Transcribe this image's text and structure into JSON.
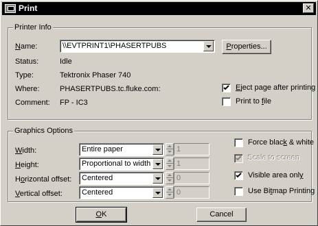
{
  "window": {
    "title": "Print",
    "close_glyph": "✕"
  },
  "printer_info": {
    "group_label": "Printer Info",
    "name_label": "Name:",
    "name_value": "\\\\EVTPRINT1\\PHASERTPUBS",
    "properties_button": "Properties...",
    "status_label": "Status:",
    "status_value": "Idle",
    "type_label": "Type:",
    "type_value": "Tektronix Phaser 740",
    "where_label": "Where:",
    "where_value": "PHASERTPUBS.tc.fluke.com:",
    "comment_label": "Comment:",
    "comment_value": "FP - IC3",
    "eject_label": "Eject page after printing",
    "eject_checked": true,
    "print_to_file_label": "Print to file",
    "print_to_file_checked": false
  },
  "graphics_options": {
    "group_label": "Graphics Options",
    "width_label": "Width:",
    "width_value": "Entire paper",
    "width_number": "1",
    "height_label": "Height:",
    "height_value": "Proportional to width",
    "height_number": "1",
    "hoffset_label": "Horizontal offset:",
    "hoffset_value": "Centered",
    "hoffset_number": "0",
    "voffset_label": "Vertical offset:",
    "voffset_value": "Centered",
    "voffset_number": "0",
    "force_bw_label": "Force black & white",
    "force_bw_checked": false,
    "scale_to_screen_label": "Scale to screen",
    "scale_to_screen_checked": true,
    "scale_to_screen_enabled": false,
    "visible_area_label": "Visible area only",
    "visible_area_checked": true,
    "bitmap_label": "Use Bitmap Printing",
    "bitmap_checked": false
  },
  "buttons": {
    "ok": "OK",
    "cancel": "Cancel"
  }
}
